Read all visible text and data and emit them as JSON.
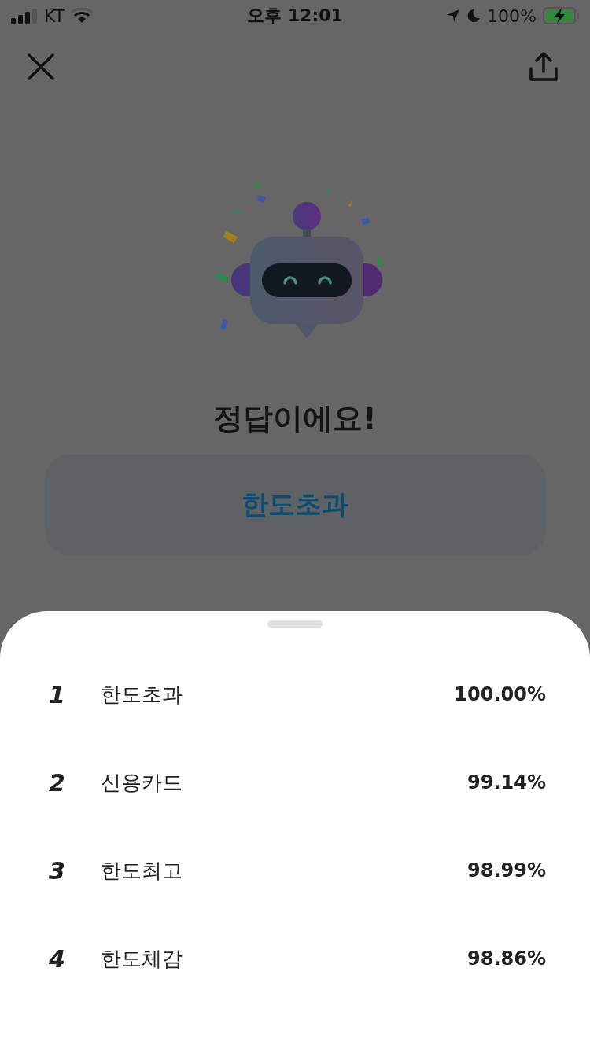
{
  "status_bar": {
    "carrier": "KT",
    "time": "오후 12:01",
    "battery": "100%"
  },
  "title": "정답이에요!",
  "answer": "한도초과",
  "results": [
    {
      "rank": "1",
      "word": "한도초과",
      "score": "100.00%"
    },
    {
      "rank": "2",
      "word": "신용카드",
      "score": "99.14%"
    },
    {
      "rank": "3",
      "word": "한도최고",
      "score": "98.99%"
    },
    {
      "rank": "4",
      "word": "한도체감",
      "score": "98.86%"
    }
  ]
}
